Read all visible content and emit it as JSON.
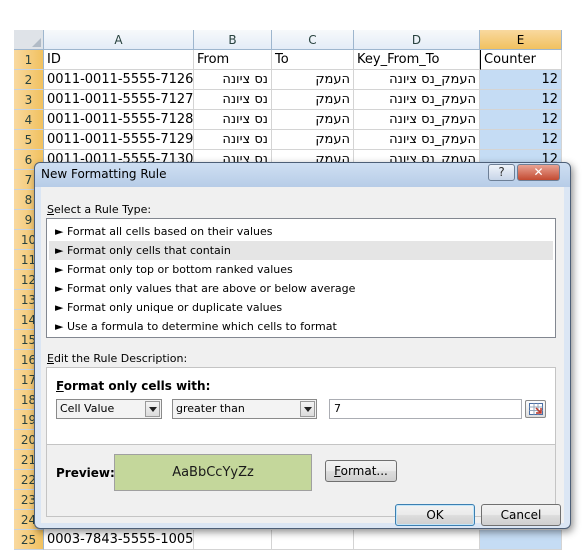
{
  "sheet": {
    "columns": [
      "A",
      "B",
      "C",
      "D",
      "E"
    ],
    "header_row": {
      "row": "1",
      "cells": [
        "ID",
        "From",
        "To",
        "Key_From_To",
        "Counter"
      ]
    },
    "rows": [
      {
        "row": "2",
        "cells": [
          "0011-0011-5555-7126",
          "נס ציונה",
          "העמק",
          "העמק_נס ציונה",
          "12"
        ]
      },
      {
        "row": "3",
        "cells": [
          "0011-0011-5555-7127",
          "נס ציונה",
          "העמק",
          "העמק_נס ציונה",
          "12"
        ]
      },
      {
        "row": "4",
        "cells": [
          "0011-0011-5555-7128",
          "נס ציונה",
          "העמק",
          "העמק_נס ציונה",
          "12"
        ]
      },
      {
        "row": "5",
        "cells": [
          "0011-0011-5555-7129",
          "נס ציונה",
          "העמק",
          "העמק_נס ציונה",
          "12"
        ]
      },
      {
        "row": "6",
        "cells": [
          "0011-0011-5555-7130",
          "נס ציונה",
          "העמק",
          "העמק_נס ציונה",
          "12"
        ]
      }
    ],
    "hidden_row_numbers": [
      "7",
      "8",
      "9",
      "10",
      "11",
      "12",
      "13",
      "14",
      "15",
      "16",
      "17",
      "18",
      "19",
      "20",
      "21",
      "22",
      "23",
      "24"
    ],
    "last_row": {
      "row": "25",
      "cells": [
        "0003-7843-5555-1005",
        "",
        "",
        "",
        ""
      ]
    },
    "selection_color": "#c5dcf4"
  },
  "dialog": {
    "title": "New Formatting Rule",
    "help_label": "?",
    "close_label": "✕",
    "rule_type_label": "Select a Rule Type:",
    "rule_types": [
      "► Format all cells based on their values",
      "► Format only cells that contain",
      "► Format only top or bottom ranked values",
      "► Format only values that are above or below average",
      "► Format only unique or duplicate values",
      "► Use a formula to determine which cells to format"
    ],
    "selected_rule_index": 1,
    "edit_description_label": "Edit the Rule Description:",
    "format_only_label": "Format only cells with:",
    "condition_field": "Cell Value",
    "operator": "greater than",
    "value": "7",
    "preview_label": "Preview:",
    "preview_text": "AaBbCcYyZz",
    "preview_color": "#c4d79b",
    "format_button": "Format...",
    "ok_button": "OK",
    "cancel_button": "Cancel"
  }
}
